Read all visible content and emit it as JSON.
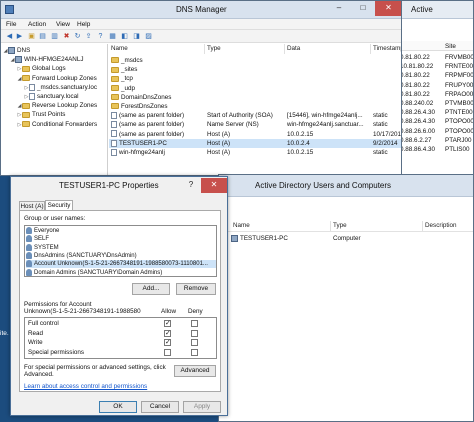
{
  "active_window": {
    "title_fragment": "Active",
    "col_site": "Site",
    "rows": [
      {
        "ip": "0.81.80.22",
        "site": "FRVMB00"
      },
      {
        "ip": "10.81.80.22",
        "site": "FRNTE00"
      },
      {
        "ip": "0.81.80.22",
        "site": "FRPMF00"
      },
      {
        "ip": "0.81.80.22",
        "site": "FRUPY00"
      },
      {
        "ip": "0.81.80.22",
        "site": "FRPAO00"
      },
      {
        "ip": "0.88.240.02",
        "site": "PTVMB00"
      },
      {
        "ip": "0.88.26.4.30",
        "site": "PTNTE00"
      },
      {
        "ip": "0.88.26.4.30",
        "site": "PTOPO00"
      },
      {
        "ip": "0.88.26.6.00",
        "site": "PTOPO00"
      },
      {
        "ip": "0.88.6.2.27",
        "site": "PTARJ00"
      },
      {
        "ip": "0.88.86.4.30",
        "site": "PTLIS00"
      }
    ]
  },
  "dns": {
    "title": "DNS Manager",
    "menu": [
      "File",
      "Action",
      "View",
      "Help"
    ],
    "tree": [
      {
        "label": "DNS",
        "level": 0,
        "icon": "dns-icon"
      },
      {
        "label": "WIN-HFMGE24ANLJ",
        "level": 1,
        "icon": "server-icon"
      },
      {
        "label": "Global Logs",
        "level": 2,
        "icon": "folder-icon"
      },
      {
        "label": "Forward Lookup Zones",
        "level": 2,
        "icon": "folder-icon"
      },
      {
        "label": "_msdcs.sanctuary.loc",
        "level": 3,
        "icon": "zone-icon"
      },
      {
        "label": "sanctuary.local",
        "level": 3,
        "icon": "zone-icon"
      },
      {
        "label": "Reverse Lookup Zones",
        "level": 2,
        "icon": "folder-icon"
      },
      {
        "label": "Trust Points",
        "level": 2,
        "icon": "folder-icon"
      },
      {
        "label": "Conditional Forwarders",
        "level": 2,
        "icon": "folder-icon"
      }
    ],
    "columns": [
      "Name",
      "Type",
      "Data",
      "Timestamp"
    ],
    "records": [
      {
        "name": "_msdcs",
        "type": "",
        "data": "",
        "ts": "",
        "icon": "folder-icon"
      },
      {
        "name": "_sites",
        "type": "",
        "data": "",
        "ts": "",
        "icon": "folder-icon"
      },
      {
        "name": "_tcp",
        "type": "",
        "data": "",
        "ts": "",
        "icon": "folder-icon"
      },
      {
        "name": "_udp",
        "type": "",
        "data": "",
        "ts": "",
        "icon": "folder-icon"
      },
      {
        "name": "DomainDnsZones",
        "type": "",
        "data": "",
        "ts": "",
        "icon": "folder-icon"
      },
      {
        "name": "ForestDnsZones",
        "type": "",
        "data": "",
        "ts": "",
        "icon": "folder-icon"
      },
      {
        "name": "(same as parent folder)",
        "type": "Start of Authority (SOA)",
        "data": "[15446], win-hfmge24anlj...",
        "ts": "static",
        "icon": "record-icon"
      },
      {
        "name": "(same as parent folder)",
        "type": "Name Server (NS)",
        "data": "win-hfmge24anlj.sanctuar...",
        "ts": "static",
        "icon": "record-icon"
      },
      {
        "name": "(same as parent folder)",
        "type": "Host (A)",
        "data": "10.0.2.15",
        "ts": "10/17/201",
        "icon": "record-icon"
      },
      {
        "name": "TESTUSER1-PC",
        "type": "Host (A)",
        "data": "10.0.2.4",
        "ts": "9/2/2014",
        "icon": "record-icon"
      },
      {
        "name": "win-hfmge24anlj",
        "type": "Host (A)",
        "data": "10.0.2.15",
        "ts": "static",
        "icon": "record-icon"
      }
    ]
  },
  "props": {
    "title": "TESTUSER1-PC Properties",
    "help": "?",
    "close": "✕",
    "tabs": [
      "Host (A)",
      "Security"
    ],
    "groups_label": "Group or user names:",
    "users": [
      "Everyone",
      "SELF",
      "SYSTEM",
      "DnsAdmins (SANCTUARY\\DnsAdmin)",
      "Account Unknown(S-1-5-21-2667348191-1988580073-1110801...",
      "Domain Admins (SANCTUARY\\Domain Admins)"
    ],
    "add_label": "Add...",
    "remove_label": "Remove",
    "perm_label_line1": "Permissions for Account",
    "perm_label_line2": "Unknown(S-1-5-21-2667348191-1988580",
    "allow_label": "Allow",
    "deny_label": "Deny",
    "perms": [
      {
        "name": "Full control",
        "allow": "✓",
        "deny": ""
      },
      {
        "name": "Read",
        "allow": "✓",
        "deny": ""
      },
      {
        "name": "Write",
        "allow": "✓",
        "deny": ""
      },
      {
        "name": "Special permissions",
        "allow": "",
        "deny": ""
      }
    ],
    "special_line1": "For special permissions or advanced settings, click",
    "special_line2": "Advanced.",
    "advanced_label": "Advanced",
    "learn_link": "Learn about access control and permissions",
    "ok_label": "OK",
    "cancel_label": "Cancel",
    "apply_label": "Apply"
  },
  "aduc": {
    "title": "Active Directory Users and Computers",
    "columns": [
      "Name",
      "Type",
      "Description"
    ],
    "rows": [
      {
        "name": "TESTUSER1-PC",
        "type": "Computer",
        "desc": ""
      }
    ]
  },
  "desktop": {
    "label": "ite."
  }
}
